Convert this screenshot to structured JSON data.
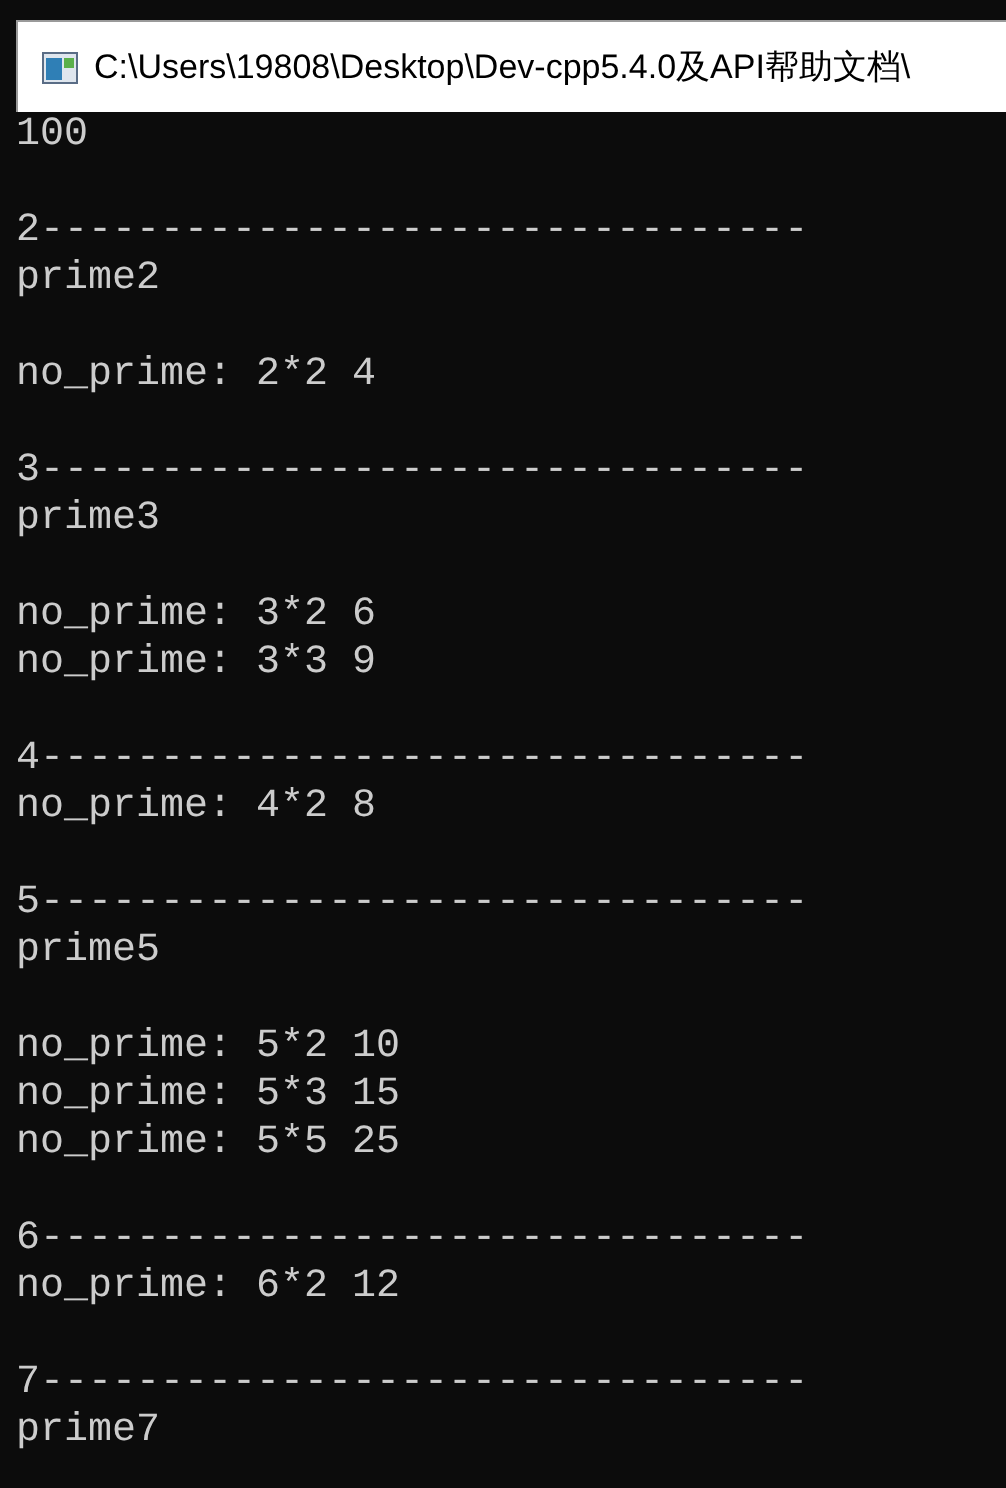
{
  "window": {
    "title": "C:\\Users\\19808\\Desktop\\Dev-cpp5.4.0及API帮助文档\\"
  },
  "console": {
    "blocks": [
      [
        "100"
      ],
      [
        "2--------------------------------",
        "prime2"
      ],
      [
        "no_prime: 2*2 4"
      ],
      [
        "3--------------------------------",
        "prime3"
      ],
      [
        "no_prime: 3*2 6",
        "no_prime: 3*3 9"
      ],
      [
        "4--------------------------------",
        "no_prime: 4*2 8"
      ],
      [
        "5--------------------------------",
        "prime5"
      ],
      [
        "no_prime: 5*2 10",
        "no_prime: 5*3 15",
        "no_prime: 5*5 25"
      ],
      [
        "6--------------------------------",
        "no_prime: 6*2 12"
      ],
      [
        "7--------------------------------",
        "prime7"
      ]
    ]
  }
}
